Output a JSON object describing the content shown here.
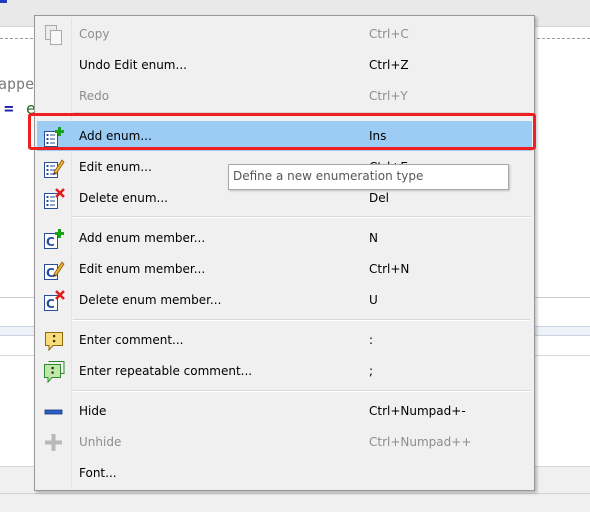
{
  "background": {
    "code_line_1": "appe",
    "code_line_2_op": "=",
    "code_line_2_rest": "e"
  },
  "menu": {
    "items": [
      {
        "label": "Copy",
        "shortcut": "Ctrl+C",
        "icon": "copy-icon",
        "enabled": false
      },
      {
        "label": "Undo Edit enum...",
        "shortcut": "Ctrl+Z",
        "icon": "",
        "enabled": true
      },
      {
        "label": "Redo",
        "shortcut": "Ctrl+Y",
        "icon": "",
        "enabled": false
      },
      {
        "label": "Add enum...",
        "shortcut": "Ins",
        "icon": "add-enum-icon",
        "enabled": true,
        "highlighted": true
      },
      {
        "label": "Edit enum...",
        "shortcut": "Ctrl+E",
        "icon": "edit-enum-icon",
        "enabled": true
      },
      {
        "label": "Delete enum...",
        "shortcut": "Del",
        "icon": "delete-enum-icon",
        "enabled": true
      },
      {
        "label": "Add enum member...",
        "shortcut": "N",
        "icon": "add-enum-member-icon",
        "enabled": true
      },
      {
        "label": "Edit enum member...",
        "shortcut": "Ctrl+N",
        "icon": "edit-enum-member-icon",
        "enabled": true
      },
      {
        "label": "Delete enum member...",
        "shortcut": "U",
        "icon": "delete-enum-member-icon",
        "enabled": true
      },
      {
        "label": "Enter comment...",
        "shortcut": ":",
        "icon": "comment-icon",
        "enabled": true
      },
      {
        "label": "Enter repeatable comment...",
        "shortcut": ";",
        "icon": "repeatable-comment-icon",
        "enabled": true
      },
      {
        "label": "Hide",
        "shortcut": "Ctrl+Numpad+-",
        "icon": "hide-icon",
        "enabled": true
      },
      {
        "label": "Unhide",
        "shortcut": "Ctrl+Numpad++",
        "icon": "unhide-icon",
        "enabled": false
      },
      {
        "label": "Font...",
        "shortcut": "",
        "icon": "",
        "enabled": true
      }
    ]
  },
  "tooltip": {
    "text": "Define a new enumeration type"
  },
  "colors": {
    "highlight_row": "#9ccbf4",
    "annotation_box": "#f02020",
    "menu_background": "#f0f0f0"
  }
}
